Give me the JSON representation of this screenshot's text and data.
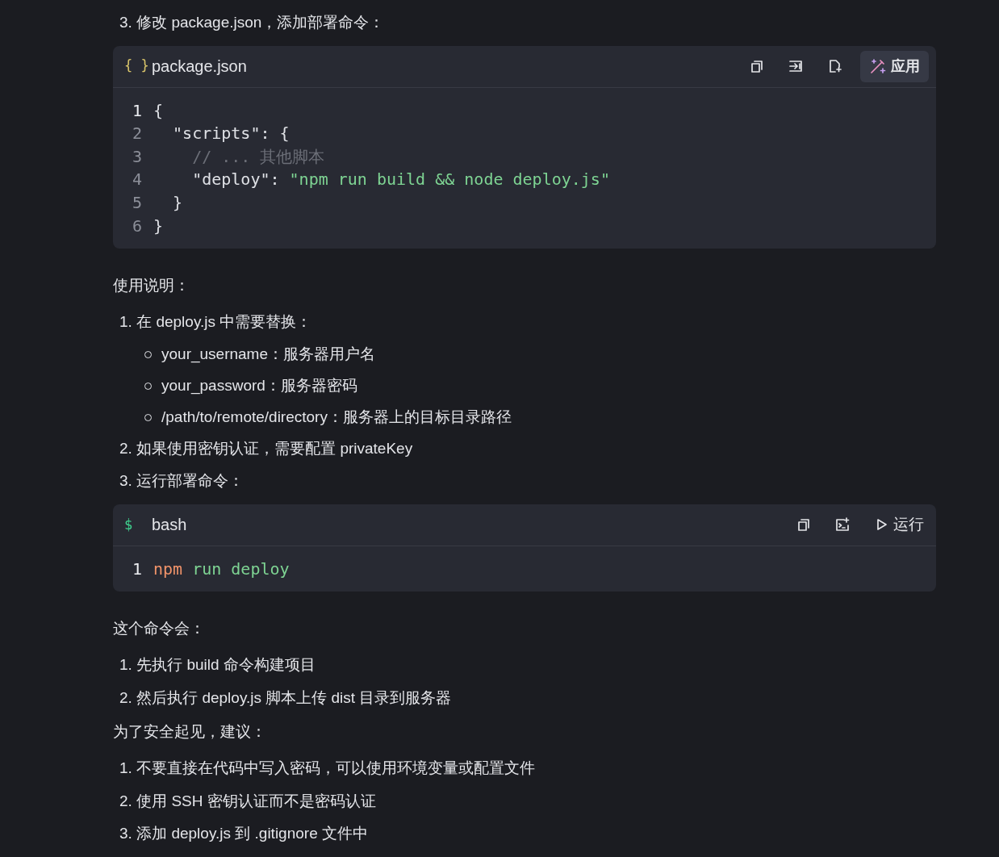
{
  "content": [
    {
      "kind": "numbered",
      "number": "3.",
      "text": "修改 package.json，添加部署命令："
    },
    {
      "kind": "code",
      "lang_icon": "{ }",
      "lang": "package.json",
      "actions": [
        {
          "kind": "copy"
        },
        {
          "kind": "insert"
        },
        {
          "kind": "new-file"
        },
        {
          "kind": "apply",
          "label": "应用"
        }
      ],
      "lines": [
        {
          "number": "1",
          "current": true,
          "tokens": [
            {
              "kind": "punct",
              "text": "{"
            }
          ]
        },
        {
          "number": "2",
          "current": false,
          "tokens": [
            {
              "kind": "punct",
              "text": "  \"scripts\": {"
            }
          ]
        },
        {
          "number": "3",
          "current": false,
          "tokens": [
            {
              "kind": "comment",
              "text": "    // ... 其他脚本"
            }
          ]
        },
        {
          "number": "4",
          "current": false,
          "tokens": [
            {
              "kind": "punct",
              "text": "    \"deploy\": "
            },
            {
              "kind": "string",
              "text": "\"npm run build && node deploy.js\""
            }
          ]
        },
        {
          "number": "5",
          "current": false,
          "tokens": [
            {
              "kind": "punct",
              "text": "  }"
            }
          ]
        },
        {
          "number": "6",
          "current": false,
          "tokens": [
            {
              "kind": "punct",
              "text": "}"
            }
          ]
        }
      ]
    },
    {
      "kind": "paragraph",
      "text": "使用说明："
    },
    {
      "kind": "numbered",
      "number": "1.",
      "text": "在 deploy.js 中需要替换："
    },
    {
      "kind": "bullet",
      "text": "your_username：服务器用户名"
    },
    {
      "kind": "bullet",
      "text": "your_password：服务器密码"
    },
    {
      "kind": "bullet",
      "text": "/path/to/remote/directory：服务器上的目标目录路径"
    },
    {
      "kind": "numbered",
      "number": "2.",
      "text": "如果使用密钥认证，需要配置 privateKey"
    },
    {
      "kind": "numbered",
      "number": "3.",
      "text": "运行部署命令："
    },
    {
      "kind": "code",
      "lang_icon": "$",
      "lang": "bash",
      "actions": [
        {
          "kind": "copy"
        },
        {
          "kind": "terminal"
        },
        {
          "kind": "run",
          "label": "运行"
        }
      ],
      "lines": [
        {
          "number": "1",
          "current": true,
          "tokens": [
            {
              "kind": "command",
              "text": "npm"
            },
            {
              "kind": "string",
              "text": " run deploy"
            }
          ]
        }
      ]
    },
    {
      "kind": "paragraph",
      "text": "这个命令会："
    },
    {
      "kind": "numbered",
      "number": "1.",
      "text": "先执行 build 命令构建项目"
    },
    {
      "kind": "numbered",
      "number": "2.",
      "text": "然后执行 deploy.js 脚本上传 dist 目录到服务器"
    },
    {
      "kind": "paragraph",
      "text": "为了安全起见，建议："
    },
    {
      "kind": "numbered",
      "number": "1.",
      "text": "不要直接在代码中写入密码，可以使用环境变量或配置文件"
    },
    {
      "kind": "numbered",
      "number": "2.",
      "text": "使用 SSH 密钥认证而不是密码认证"
    },
    {
      "kind": "numbered",
      "number": "3.",
      "text": "添加 deploy.js 到 .gitignore 文件中"
    }
  ]
}
